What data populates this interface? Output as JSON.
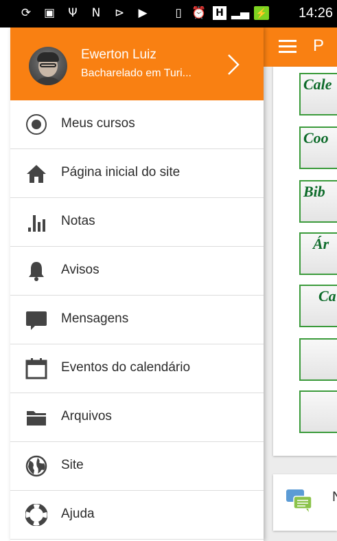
{
  "status_bar": {
    "time": "14:26",
    "left_icons": [
      "sync-icon",
      "image-icon",
      "usb-icon",
      "n-icon",
      "send-icon",
      "play-icon"
    ],
    "right_icons": [
      "vibrate-icon",
      "alarm-icon",
      "h-network-icon",
      "signal-icon",
      "battery-charging-icon"
    ],
    "h_label": "H"
  },
  "app_bar": {
    "title": "P"
  },
  "drawer": {
    "user_name": "Ewerton Luiz",
    "user_course": "Bacharelado em Turi...",
    "items": [
      {
        "label": "Meus cursos",
        "icon": "target-icon"
      },
      {
        "label": "Página inicial do site",
        "icon": "home-icon"
      },
      {
        "label": "Notas",
        "icon": "bar-chart-icon"
      },
      {
        "label": "Avisos",
        "icon": "bell-icon"
      },
      {
        "label": "Mensagens",
        "icon": "chat-bubble-icon"
      },
      {
        "label": "Eventos do calendário",
        "icon": "calendar-icon"
      },
      {
        "label": "Arquivos",
        "icon": "folder-icon"
      },
      {
        "label": "Site",
        "icon": "globe-icon"
      },
      {
        "label": "Ajuda",
        "icon": "lifebuoy-icon"
      }
    ]
  },
  "background": {
    "tiles": [
      "Cale",
      "Coo",
      "Bib",
      "Ár",
      "Ca",
      "",
      ""
    ],
    "message_letter": "N"
  },
  "colors": {
    "accent": "#f98012",
    "tile_border": "#3a9a3a",
    "tile_text": "#0d6b2a"
  }
}
